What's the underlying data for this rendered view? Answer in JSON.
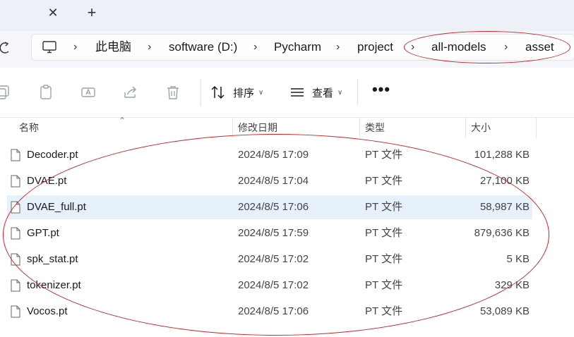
{
  "tabs": {
    "close_glyph": "✕",
    "new_tab_glyph": "+"
  },
  "breadcrumb": [
    {
      "label": "此电脑"
    },
    {
      "label": "software (D:)"
    },
    {
      "label": "Pycharm"
    },
    {
      "label": "project"
    },
    {
      "label": "all-models"
    },
    {
      "label": "asset"
    }
  ],
  "breadcrumb_separator": "›",
  "toolbar": {
    "icons": [
      "copy-icon",
      "paste-icon",
      "rename-icon",
      "share-icon",
      "delete-icon"
    ],
    "sort_label": "排序",
    "view_label": "查看",
    "more_label": "•••"
  },
  "columns": {
    "name": "名称",
    "date": "修改日期",
    "type": "类型",
    "size": "大小"
  },
  "files": [
    {
      "name": "Decoder.pt",
      "date": "2024/8/5 17:09",
      "type": "PT 文件",
      "size": "101,288 KB",
      "selected": false
    },
    {
      "name": "DVAE.pt",
      "date": "2024/8/5 17:04",
      "type": "PT 文件",
      "size": "27,100 KB",
      "selected": false
    },
    {
      "name": "DVAE_full.pt",
      "date": "2024/8/5 17:06",
      "type": "PT 文件",
      "size": "58,987 KB",
      "selected": true
    },
    {
      "name": "GPT.pt",
      "date": "2024/8/5 17:59",
      "type": "PT 文件",
      "size": "879,636 KB",
      "selected": false
    },
    {
      "name": "spk_stat.pt",
      "date": "2024/8/5 17:02",
      "type": "PT 文件",
      "size": "5 KB",
      "selected": false
    },
    {
      "name": "tokenizer.pt",
      "date": "2024/8/5 17:02",
      "type": "PT 文件",
      "size": "329 KB",
      "selected": false
    },
    {
      "name": "Vocos.pt",
      "date": "2024/8/5 17:06",
      "type": "PT 文件",
      "size": "53,089 KB",
      "selected": false
    }
  ],
  "colors": {
    "annotation": "#d12222",
    "selection": "#e6f1fb",
    "tabstrip": "#eef0f7"
  }
}
